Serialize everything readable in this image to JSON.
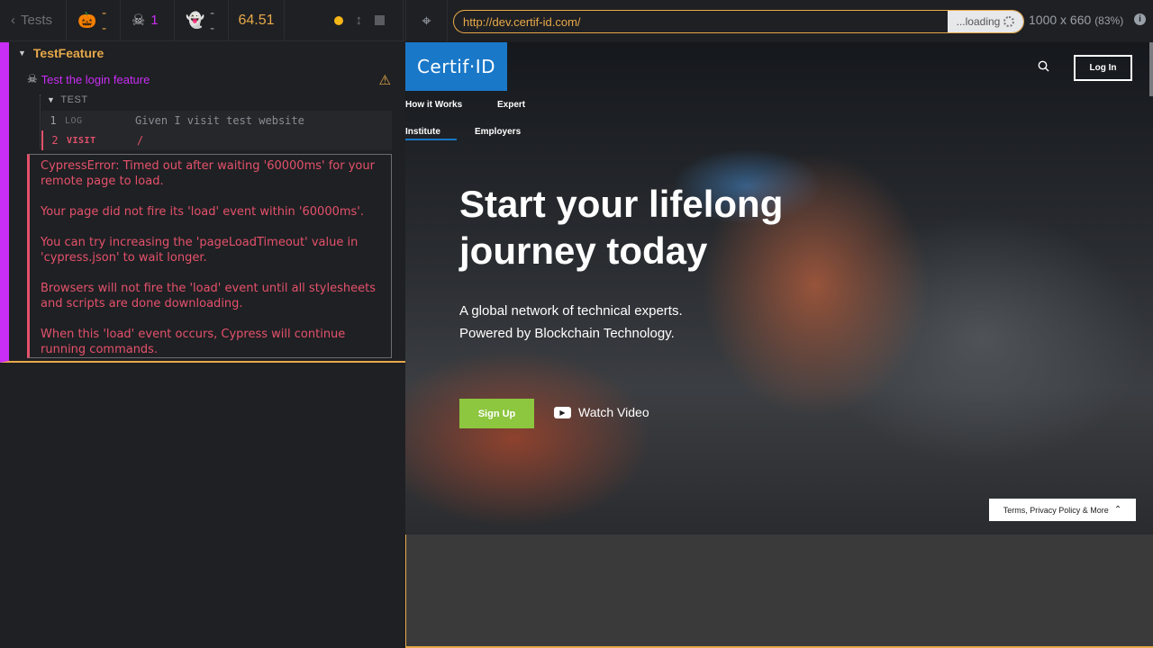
{
  "reporter": {
    "tests_label": "Tests",
    "stats": {
      "passed": "--",
      "failed": "1",
      "pending": "--"
    },
    "duration": "64.51",
    "suite_title": "TestFeature",
    "test_title": "Test the login feature",
    "hook_label": "TEST",
    "commands": [
      {
        "number": "1",
        "name": "LOG",
        "message": "Given I visit test website"
      },
      {
        "number": "2",
        "name": "VISIT",
        "message": "/"
      }
    ],
    "error_paragraphs": [
      "CypressError: Timed out after waiting '60000ms' for your remote page to load.",
      "Your page did not fire its 'load' event within '60000ms'.",
      "You can try increasing the 'pageLoadTimeout' value in 'cypress.json' to wait longer.",
      "Browsers will not fire the 'load' event until all stylesheets and scripts are done downloading.",
      "When this 'load' event occurs, Cypress will continue running commands."
    ]
  },
  "aut_bar": {
    "url": "http://dev.certif-id.com/",
    "loading_label": "...loading",
    "viewport": "1000 x 660",
    "scale": "(83%)"
  },
  "site": {
    "logo_text": "Certif·ID",
    "nav": {
      "how": "How it Works",
      "expert": "Expert",
      "institute": "Institute",
      "employers": "Employers"
    },
    "login_label": "Log In",
    "hero_title_line1": "Start your lifelong",
    "hero_title_line2": "journey today",
    "hero_sub_line1": "A global network of technical experts.",
    "hero_sub_line2": "Powered by Blockchain Technology.",
    "signup_label": "Sign Up",
    "watch_label": "Watch Video",
    "terms_label": "Terms, Privacy Policy & More"
  },
  "colors": {
    "accent": "#e8a94a",
    "failed": "#c82ef5",
    "error": "#e4516b",
    "brand_blue": "#1a78c8",
    "signup_green": "#8dc63f"
  },
  "icons": [
    "chevron-left-icon",
    "pumpkin-icon",
    "skull-icon",
    "ghost-icon",
    "running-dot-icon",
    "updown-icon",
    "stop-icon",
    "crosshair-icon",
    "spinner-icon",
    "info-icon",
    "warning-icon",
    "search-icon",
    "youtube-icon",
    "chevron-up-icon"
  ]
}
